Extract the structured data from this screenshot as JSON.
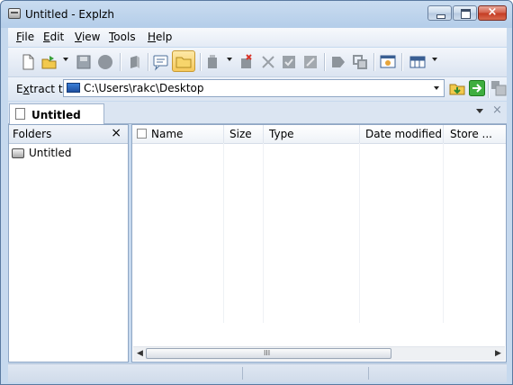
{
  "window": {
    "title": "Untitled - Explzh",
    "controls": {
      "minimize": "minimize",
      "maximize": "maximize",
      "close": "×"
    }
  },
  "menu": {
    "items": [
      {
        "label": "File",
        "accel": "F",
        "rest": "ile"
      },
      {
        "label": "Edit",
        "accel": "E",
        "rest": "dit"
      },
      {
        "label": "View",
        "accel": "V",
        "rest": "iew"
      },
      {
        "label": "Tools",
        "accel": "T",
        "rest": "ools"
      },
      {
        "label": "Help",
        "accel": "H",
        "rest": "elp"
      }
    ]
  },
  "toolbar": {
    "buttons": [
      {
        "icon": "new-document-icon"
      },
      {
        "icon": "open-folder-icon"
      },
      {
        "icon": "save-icon"
      },
      {
        "icon": "stop-icon"
      },
      {
        "icon": "add-icon"
      },
      {
        "icon": "comment-icon"
      },
      {
        "icon": "folder-view-icon",
        "active": true
      },
      {
        "icon": "extract-icon"
      },
      {
        "icon": "delete-icon"
      },
      {
        "icon": "cut-icon"
      },
      {
        "icon": "test-icon"
      },
      {
        "icon": "properties-icon"
      },
      {
        "icon": "label-icon"
      },
      {
        "icon": "convert-icon"
      },
      {
        "icon": "preview-icon"
      },
      {
        "icon": "view-mode-icon"
      }
    ]
  },
  "address": {
    "label": "Extract to",
    "accel": "x",
    "path": "C:\\Users\\rakc\\Desktop"
  },
  "tabs": [
    {
      "label": "Untitled",
      "active": true
    }
  ],
  "folders": {
    "title": "Folders",
    "close": "×",
    "items": [
      {
        "label": "Untitled"
      }
    ]
  },
  "list": {
    "columns": [
      "Name",
      "Size",
      "Type",
      "Date modified",
      "Store ..."
    ],
    "rows": []
  },
  "scrollbar": {
    "grip": "III"
  },
  "colors": {
    "accent": "#f6c95b",
    "titlebar": "#b4cde9",
    "close": "#c43a22"
  }
}
